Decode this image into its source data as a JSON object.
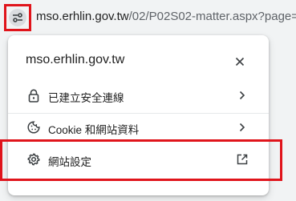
{
  "address_bar": {
    "site_info_icon": "tune-icon",
    "url_host": "mso.erhlin.gov.tw",
    "url_rest": "/02/P02S02-matter.aspx?page="
  },
  "popup": {
    "title": "mso.erhlin.gov.tw",
    "close_icon": "close-icon",
    "items": [
      {
        "icon": "lock-icon",
        "label": "已建立安全連線"
      },
      {
        "icon": "cookie-icon",
        "label": "Cookie 和網站資料"
      },
      {
        "icon": "gear-icon",
        "label": "網站設定"
      }
    ]
  },
  "colors": {
    "highlight": "#e0141b",
    "popup_bg": "#ffffff",
    "page_bg": "#f1f3f4"
  }
}
